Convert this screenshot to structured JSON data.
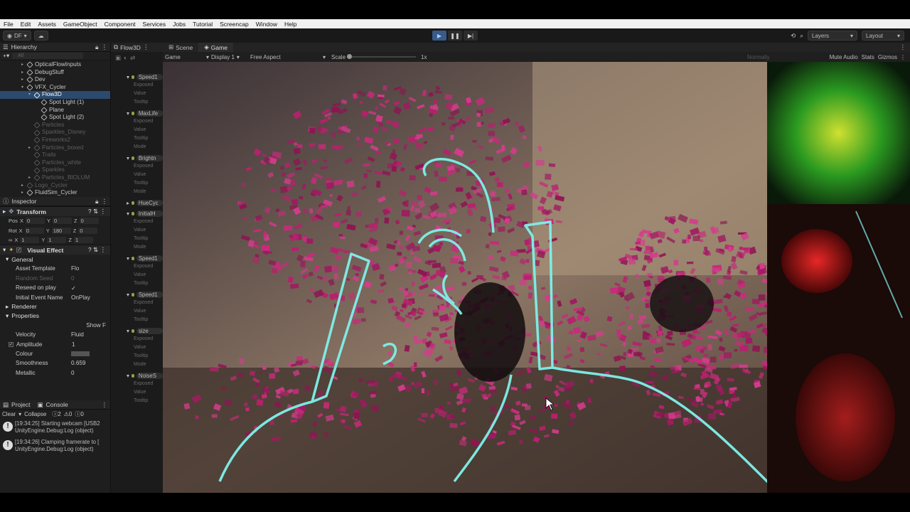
{
  "menu": [
    "File",
    "Edit",
    "Assets",
    "GameObject",
    "Component",
    "Services",
    "Jobs",
    "Tutorial",
    "Screencap",
    "Window",
    "Help"
  ],
  "toolbar": {
    "account": "DF",
    "layers": "Layers",
    "layout": "Layout"
  },
  "hierarchy": {
    "title": "Hierarchy",
    "search_placeholder": "All",
    "items": [
      {
        "label": "OpticalFlowInputs",
        "dim": false
      },
      {
        "label": "DebugStuff",
        "dim": false
      },
      {
        "label": "Dev",
        "dim": false
      },
      {
        "label": "VFX_Cycler",
        "dim": false
      },
      {
        "label": "Flow3D",
        "dim": false
      },
      {
        "label": "Spot Light (1)",
        "dim": false
      },
      {
        "label": "Plane",
        "dim": false
      },
      {
        "label": "Spot Light (2)",
        "dim": false
      },
      {
        "label": "Particles",
        "dim": true
      },
      {
        "label": "Sparkles_Disney",
        "dim": true
      },
      {
        "label": "Fireworks2",
        "dim": true
      },
      {
        "label": "Particles_boxed",
        "dim": true
      },
      {
        "label": "Trails",
        "dim": true
      },
      {
        "label": "Particles_white",
        "dim": true
      },
      {
        "label": "Sparkles",
        "dim": true
      },
      {
        "label": "Particles_BIOLUM",
        "dim": true
      },
      {
        "label": "Logo_Cycler",
        "dim": true
      },
      {
        "label": "FluidSim_Cycler",
        "dim": false
      }
    ]
  },
  "inspector": {
    "title": "Inspector",
    "transform": {
      "title": "Transform",
      "pos": {
        "label": "Pos",
        "x": "0",
        "y": "0",
        "z": "0"
      },
      "rot": {
        "label": "Rot",
        "x": "0",
        "y": "180",
        "z": "0"
      },
      "scale": {
        "x": "1",
        "y": "1",
        "z": "1"
      }
    },
    "visual_effect": {
      "title": "Visual Effect",
      "general": "General",
      "asset_template_label": "Asset Template",
      "asset_template_value": "Flo",
      "random_seed_label": "Random Seed",
      "random_seed_value": "0",
      "reseed_label": "Reseed on play",
      "initial_event_label": "Initial Event Name",
      "initial_event_value": "OnPlay",
      "renderer": "Renderer",
      "properties": "Properties",
      "show_label": "Show F",
      "velocity_label": "Velocity",
      "velocity_value": "Fluid",
      "amplitude_label": "Amplitude",
      "amplitude_value": "1",
      "colour_label": "Colour",
      "smoothness_label": "Smoothness",
      "smoothness_value": "0.659",
      "metallic_label": "Metallic",
      "metallic_value": "0"
    }
  },
  "console": {
    "project_tab": "Project",
    "console_tab": "Console",
    "clear": "Clear",
    "collapse": "Collapse",
    "count_info": "2",
    "count_warn": "0",
    "count_err": "0",
    "logs": [
      {
        "line1": "[19:34:25] Starting webcam [USB2",
        "line2": "UnityEngine.Debug:Log (object)"
      },
      {
        "line1": "[19:34:26] Clamping framerate to [",
        "line2": "UnityEngine.Debug:Log (object)"
      }
    ]
  },
  "blackboard": {
    "title": "Flow3D",
    "items": [
      {
        "name": "Speed1",
        "rows": [
          "Exposed",
          "Value",
          "Tooltip"
        ]
      },
      {
        "name": "MaxLife",
        "rows": [
          "Exposed",
          "Value",
          "Tooltip",
          "Mode"
        ]
      },
      {
        "name": "Brightn",
        "rows": [
          "Exposed",
          "Value",
          "Tooltip",
          "Mode"
        ]
      },
      {
        "name": "HueCyc",
        "rows": []
      },
      {
        "name": "InitialH",
        "rows": [
          "Exposed",
          "Value",
          "Tooltip",
          "Mode"
        ]
      },
      {
        "name": "Speed1",
        "rows": [
          "Exposed",
          "Value",
          "Tooltip"
        ]
      },
      {
        "name": "Speed1",
        "rows": [
          "Exposed",
          "Value",
          "Tooltip"
        ]
      },
      {
        "name": "size",
        "rows": [
          "Exposed",
          "Value",
          "Tooltip",
          "Mode"
        ]
      },
      {
        "name": "NoiseS",
        "rows": [
          "Exposed",
          "Value",
          "Tooltip"
        ]
      }
    ]
  },
  "game_view": {
    "scene_tab": "Scene",
    "game_tab": "Game",
    "mode": "Game",
    "display": "Display 1",
    "aspect": "Free Aspect",
    "scale_label": "Scale",
    "scale_value": "1x",
    "normally": "Normally",
    "mute": "Mute Audio",
    "stats": "Stats",
    "gizmos": "Gizmos"
  },
  "colors": {
    "accent": "#3a5a8a",
    "particles": "#b8206e",
    "outline": "#7ff0ea"
  }
}
